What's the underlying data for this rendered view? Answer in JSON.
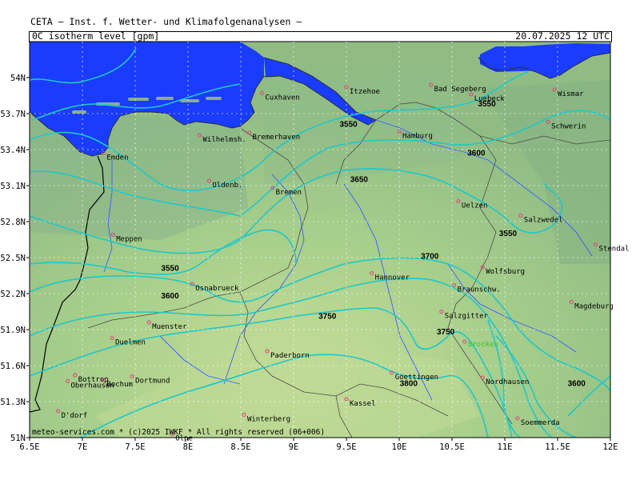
{
  "header": {
    "title": "CETA — Inst. f. Wetter- und Klimafolgenanalysen —",
    "field": "0C_isotherm_level_[gpm]",
    "valid_time": "20.07.2025 12 UTC"
  },
  "footer": "meteo-services.com * (c)2025 IWKF * All rights reserved (06+006)",
  "axes": {
    "lat_ticks": [
      "54N",
      "53.7N",
      "53.4N",
      "53.1N",
      "52.8N",
      "52.5N",
      "52.2N",
      "51.9N",
      "51.6N",
      "51.3N",
      "51N"
    ],
    "lon_ticks": [
      "6.5E",
      "7E",
      "7.5E",
      "8E",
      "8.5E",
      "9E",
      "9.5E",
      "10E",
      "10.5E",
      "11E",
      "11.5E",
      "12E"
    ]
  },
  "colors": {
    "sea": "#1a3cff",
    "land_low": "#8cba80",
    "land_high": "#b8d890",
    "contour": "#1ec8c8",
    "border": "#4a4a4a",
    "river": "#3a5cff",
    "brocken": "#2ec82e"
  },
  "cities": [
    {
      "name": "Cuxhaven",
      "lon": 8.7,
      "lat": 53.87
    },
    {
      "name": "Itzehoe",
      "lon": 9.5,
      "lat": 53.92
    },
    {
      "name": "Bad Segeberg",
      "lon": 10.3,
      "lat": 53.94
    },
    {
      "name": "Luebeck",
      "lon": 10.68,
      "lat": 53.86
    },
    {
      "name": "Wismar",
      "lon": 11.47,
      "lat": 53.9
    },
    {
      "name": "Wilhelmsh.",
      "lon": 8.11,
      "lat": 53.52
    },
    {
      "name": "Bremerhaven",
      "lon": 8.58,
      "lat": 53.54
    },
    {
      "name": "Hamburg",
      "lon": 10.0,
      "lat": 53.55
    },
    {
      "name": "Schwerin",
      "lon": 11.41,
      "lat": 53.63
    },
    {
      "name": "Emden",
      "lon": 7.2,
      "lat": 53.37
    },
    {
      "name": "Oldenb.",
      "lon": 8.2,
      "lat": 53.14
    },
    {
      "name": "Bremen",
      "lon": 8.8,
      "lat": 53.08
    },
    {
      "name": "Uelzen",
      "lon": 10.56,
      "lat": 52.97
    },
    {
      "name": "Salzwedel",
      "lon": 11.15,
      "lat": 52.85
    },
    {
      "name": "Meppen",
      "lon": 7.29,
      "lat": 52.69
    },
    {
      "name": "Stendal",
      "lon": 11.86,
      "lat": 52.61
    },
    {
      "name": "Hannover",
      "lon": 9.74,
      "lat": 52.37
    },
    {
      "name": "Wolfsburg",
      "lon": 10.79,
      "lat": 52.42
    },
    {
      "name": "Osnabrueck",
      "lon": 8.04,
      "lat": 52.28
    },
    {
      "name": "Braunschw.",
      "lon": 10.52,
      "lat": 52.27
    },
    {
      "name": "Magdeburg",
      "lon": 11.63,
      "lat": 52.13
    },
    {
      "name": "Salzgitter",
      "lon": 10.4,
      "lat": 52.05
    },
    {
      "name": "Muenster",
      "lon": 7.63,
      "lat": 51.96
    },
    {
      "name": "Duelmen",
      "lon": 7.28,
      "lat": 51.83
    },
    {
      "name": "Paderborn",
      "lon": 8.75,
      "lat": 51.72
    },
    {
      "name": "Goettingen",
      "lon": 9.93,
      "lat": 51.54
    },
    {
      "name": "Bottrop",
      "lon": 6.93,
      "lat": 51.52
    },
    {
      "name": "Dortmund",
      "lon": 7.47,
      "lat": 51.51
    },
    {
      "name": "Oberhausen",
      "lon": 6.86,
      "lat": 51.47
    },
    {
      "name": "Bochum",
      "lon": 7.2,
      "lat": 51.48
    },
    {
      "name": "Nordhausen",
      "lon": 10.79,
      "lat": 51.5
    },
    {
      "name": "Kassel",
      "lon": 9.5,
      "lat": 51.32
    },
    {
      "name": "Soemmerda",
      "lon": 11.12,
      "lat": 51.16
    },
    {
      "name": "D'dorf",
      "lon": 6.77,
      "lat": 51.22
    },
    {
      "name": "Winterberg",
      "lon": 8.53,
      "lat": 51.19
    },
    {
      "name": "Olpe",
      "lon": 7.85,
      "lat": 51.03
    }
  ],
  "brocken": {
    "name": "Brocken",
    "lon": 10.62,
    "lat": 51.8
  },
  "contour_labels": [
    {
      "text": "3550",
      "lon": 9.52,
      "lat": 53.59
    },
    {
      "text": "3550",
      "lon": 10.83,
      "lat": 53.76
    },
    {
      "text": "3600",
      "lon": 10.73,
      "lat": 53.35
    },
    {
      "text": "3650",
      "lon": 9.62,
      "lat": 53.13
    },
    {
      "text": "3550",
      "lon": 11.03,
      "lat": 52.68
    },
    {
      "text": "3700",
      "lon": 10.29,
      "lat": 52.49
    },
    {
      "text": "3550",
      "lon": 7.83,
      "lat": 52.39
    },
    {
      "text": "3600",
      "lon": 7.83,
      "lat": 52.16
    },
    {
      "text": "3750",
      "lon": 9.32,
      "lat": 51.99
    },
    {
      "text": "3750",
      "lon": 10.44,
      "lat": 51.86
    },
    {
      "text": "3800",
      "lon": 10.09,
      "lat": 51.43
    },
    {
      "text": "3600",
      "lon": 11.68,
      "lat": 51.43
    }
  ]
}
